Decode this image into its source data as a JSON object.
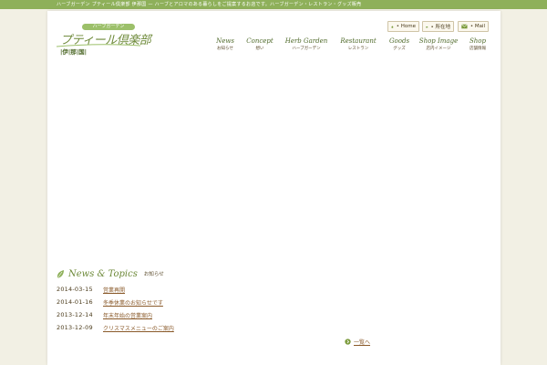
{
  "topbar": {
    "text": "ハーブガーデン プティール倶楽部 伊那国 — ハーブとアロマのある暮らしをご提案するお店です。ハーブガーデン・レストラン・グッズ販売"
  },
  "logo": {
    "badge": "ハーブガーデン",
    "main": "プティール倶楽部",
    "sub": "|伊|那|国|"
  },
  "utility": [
    {
      "label": "• Home",
      "icon": "home-icon"
    },
    {
      "label": "• 所在地",
      "icon": "car-icon"
    },
    {
      "label": "• Mail",
      "icon": "mail-icon"
    }
  ],
  "nav": [
    {
      "en": "News",
      "jp": "お知らせ"
    },
    {
      "en": "Concept",
      "jp": "想い"
    },
    {
      "en": "Herb Garden",
      "jp": "ハーブガーデン"
    },
    {
      "en": "Restaurant",
      "jp": "レストラン"
    },
    {
      "en": "Goods",
      "jp": "グッズ"
    },
    {
      "en": "Shop Image",
      "jp": "店内イメージ"
    },
    {
      "en": "Shop",
      "jp": "店舗情報"
    }
  ],
  "news": {
    "title": "News & Topics",
    "subtitle": "お知らせ",
    "items": [
      {
        "date": "2014-03-15",
        "text": "営業再開"
      },
      {
        "date": "2014-01-16",
        "text": "冬季休業のお知らせです"
      },
      {
        "date": "2013-12-14",
        "text": "年末年始の営業案内"
      },
      {
        "date": "2013-12-09",
        "text": "クリスマスメニューのご案内"
      }
    ],
    "more": "一覧へ"
  },
  "colors": {
    "accent_green": "#8eb05a",
    "text_brown": "#4a3a1a",
    "link_brown": "#8a5a2a"
  }
}
